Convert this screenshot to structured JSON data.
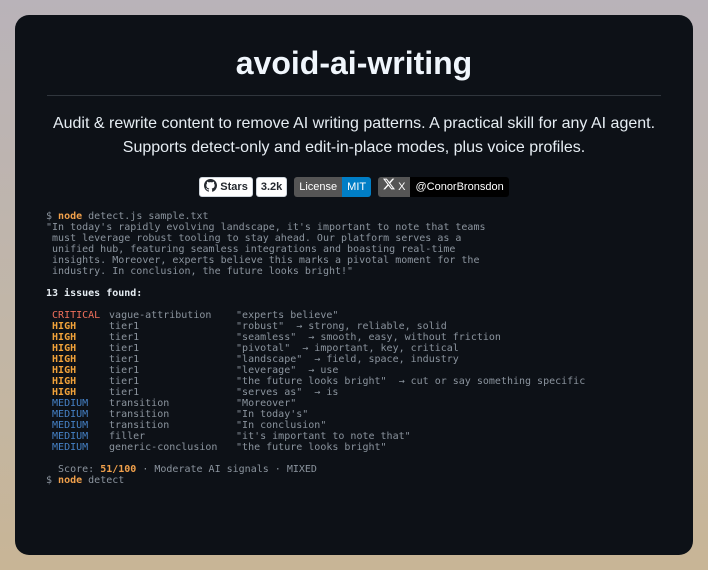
{
  "title": "avoid-ai-writing",
  "description_line1": "Audit & rewrite content to remove AI writing patterns. A practical skill for any AI agent.",
  "description_line2": "Supports detect-only and edit-in-place modes, plus voice profiles.",
  "badges": {
    "github_label": "Stars",
    "github_count": "3.2k",
    "license_label": "License",
    "license_value": "MIT",
    "x_label": "X",
    "x_value": "@ConorBronsdon"
  },
  "terminal": {
    "prompt": "$",
    "cmd_node": "node",
    "cmd_args": " detect.js sample.txt",
    "sample_lines": [
      "\"In today's rapidly evolving landscape, it's important to note that teams",
      " must leverage robust tooling to stay ahead. Our platform serves as a",
      " unified hub, featuring seamless integrations and boasting real-time",
      " insights. Moreover, experts believe this marks a pivotal moment for the",
      " industry. In conclusion, the future looks bright!\""
    ],
    "issues_header": "13 issues found:",
    "issues": [
      {
        "severity": "CRITICAL",
        "level": "critical",
        "category": "vague-attribution",
        "match": "\"experts believe\""
      },
      {
        "severity": "HIGH",
        "level": "high",
        "category": "tier1",
        "match": "\"robust\"  → strong, reliable, solid"
      },
      {
        "severity": "HIGH",
        "level": "high",
        "category": "tier1",
        "match": "\"seamless\"  → smooth, easy, without friction"
      },
      {
        "severity": "HIGH",
        "level": "high",
        "category": "tier1",
        "match": "\"pivotal\"  → important, key, critical"
      },
      {
        "severity": "HIGH",
        "level": "high",
        "category": "tier1",
        "match": "\"landscape\"  → field, space, industry"
      },
      {
        "severity": "HIGH",
        "level": "high",
        "category": "tier1",
        "match": "\"leverage\"  → use"
      },
      {
        "severity": "HIGH",
        "level": "high",
        "category": "tier1",
        "match": "\"the future looks bright\"  → cut or say something specific"
      },
      {
        "severity": "HIGH",
        "level": "high",
        "category": "tier1",
        "match": "\"serves as\"  → is"
      },
      {
        "severity": "MEDIUM",
        "level": "medium",
        "category": "transition",
        "match": "\"Moreover\""
      },
      {
        "severity": "MEDIUM",
        "level": "medium",
        "category": "transition",
        "match": "\"In today's\""
      },
      {
        "severity": "MEDIUM",
        "level": "medium",
        "category": "transition",
        "match": "\"In conclusion\""
      },
      {
        "severity": "MEDIUM",
        "level": "medium",
        "category": "filler",
        "match": "\"it's important to note that\""
      },
      {
        "severity": "MEDIUM",
        "level": "medium",
        "category": "generic-conclusion",
        "match": "\"the future looks bright\""
      }
    ],
    "score_prefix": "  Score: ",
    "score_value": "51/100",
    "score_suffix": " · Moderate AI signals · MIXED",
    "cmd2_node": "node",
    "cmd2_args": " detect"
  }
}
